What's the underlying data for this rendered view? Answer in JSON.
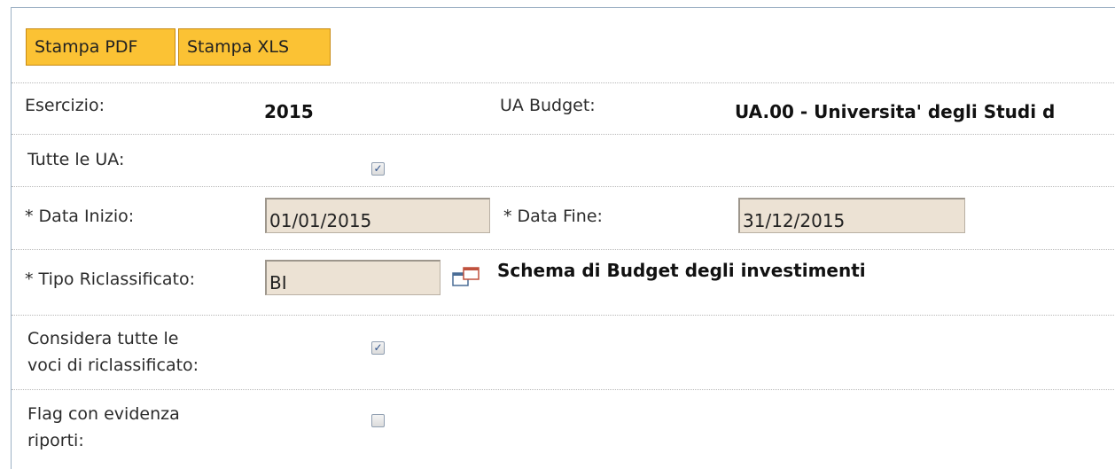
{
  "toolbar": {
    "print_pdf_label": "Stampa PDF",
    "print_xls_label": "Stampa XLS"
  },
  "form": {
    "esercizio": {
      "label": "Esercizio:",
      "value": "2015"
    },
    "ua_budget": {
      "label": "UA Budget:",
      "value": "UA.00 - Universita' degli Studi d"
    },
    "tutte_le_ua": {
      "label": "Tutte le UA:",
      "checked": true
    },
    "data_inizio": {
      "required_mark": "*",
      "label": "Data Inizio:",
      "value": "01/01/2015"
    },
    "data_fine": {
      "required_mark": "*",
      "label": "Data Fine:",
      "value": "31/12/2015"
    },
    "tipo_riclassificato": {
      "required_mark": "*",
      "label": "Tipo Riclassificato:",
      "value": "BI",
      "description": "Schema di Budget degli investimenti",
      "lookup_icon": "lookup-window-icon"
    },
    "considera_tutte": {
      "label_line1": "Considera tutte le",
      "label_line2": "voci di riclassificato:",
      "checked": true
    },
    "flag_evidenza": {
      "label_line1": "Flag con evidenza",
      "label_line2": "riporti:",
      "checked": false
    }
  },
  "colors": {
    "button_bg": "#fbc234",
    "input_bg": "#ece2d4",
    "frame_border": "#9cb0c4"
  }
}
